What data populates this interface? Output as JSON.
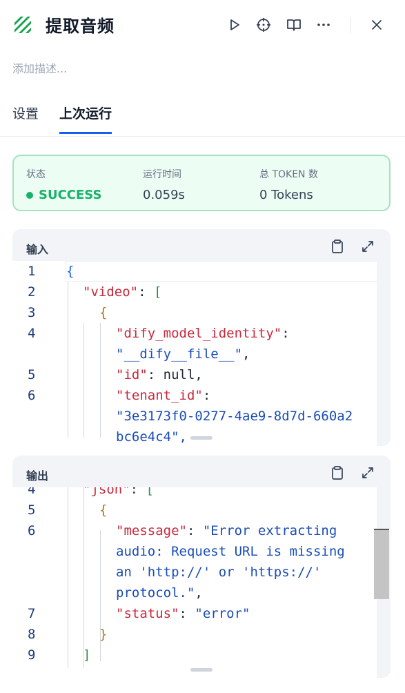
{
  "header": {
    "title": "提取音频",
    "icon": "code-extractor-icon",
    "brand_color": "#12a34b"
  },
  "description_placeholder": "添加描述...",
  "tabs": [
    {
      "label": "设置",
      "active": false
    },
    {
      "label": "上次运行",
      "active": true
    }
  ],
  "status": {
    "status_label": "状态",
    "status_value": "SUCCESS",
    "time_label": "运行时间",
    "time_value": "0.059s",
    "token_label": "总 TOKEN 数",
    "token_value": "0 Tokens"
  },
  "input_panel": {
    "title": "输入",
    "lines": [
      {
        "n": "1",
        "text": "{"
      },
      {
        "n": "2",
        "key": "\"video\"",
        "rest": ": ["
      },
      {
        "n": "3",
        "text": "{"
      },
      {
        "n": "4",
        "key": "\"dify_model_identity\"",
        "rest": ":"
      },
      {
        "n": "",
        "str": "\"__dify__file__\"",
        "rest": ","
      },
      {
        "n": "5",
        "key": "\"id\"",
        "rest": ": null,"
      },
      {
        "n": "6",
        "key": "\"tenant_id\"",
        "rest": ":"
      },
      {
        "n": "",
        "str": "\"3e3173f0-0277-4ae9-8d7d-660a2"
      },
      {
        "n": "",
        "str": "bc6e4c4\","
      }
    ]
  },
  "output_panel": {
    "title": "输出",
    "lines": [
      {
        "n": "4",
        "key": "\"json\"",
        "rest": ": ["
      },
      {
        "n": "5",
        "text": "{"
      },
      {
        "n": "6",
        "key": "\"message\"",
        "rest": ": ",
        "str": "\"Error extracting"
      },
      {
        "n": "",
        "str": "audio: Request URL is missing"
      },
      {
        "n": "",
        "str": "an 'http://' or 'https://'"
      },
      {
        "n": "",
        "str": "protocol.\"",
        "rest": ","
      },
      {
        "n": "7",
        "key": "\"status\"",
        "rest": ": ",
        "str": "\"error\""
      },
      {
        "n": "8",
        "text": "}"
      },
      {
        "n": "9",
        "text": "]"
      }
    ]
  },
  "icons": {
    "run": "play-icon",
    "debug": "crosshair-icon",
    "help": "book-icon",
    "more": "more-icon",
    "close": "close-icon",
    "copy": "clipboard-icon",
    "expand": "expand-icon"
  }
}
